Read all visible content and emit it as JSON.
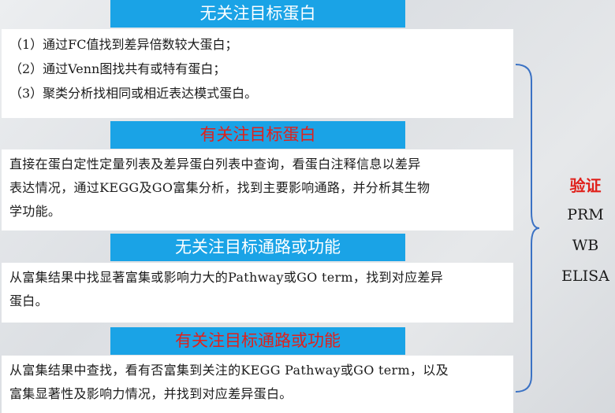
{
  "sections": [
    {
      "title": "无关注目标蛋白",
      "title_color": "#ffffff",
      "lines": [
        "（1）通过FC值找到差异倍数较大蛋白；",
        "（2）通过Venn图找共有或特有蛋白；",
        "（3）聚类分析找相同或相近表达模式蛋白。"
      ]
    },
    {
      "title": "有关注目标蛋白",
      "title_color": "#e0201b",
      "lines": [
        "直接在蛋白定性定量列表及差异蛋白列表中查询，看蛋白注释信息以差异",
        "表达情况，通过KEGG及GO富集分析，找到主要影响通路，并分析其生物",
        "学功能。"
      ]
    },
    {
      "title": "无关注目标通路或功能",
      "title_color": "#ffffff",
      "lines": [
        "从富集结果中找显著富集或影响力大的Pathway或GO  term，找到对应差异",
        "蛋白。"
      ]
    },
    {
      "title": "有关注目标通路或功能",
      "title_color": "#e0201b",
      "lines": [
        "从富集结果中查找，看有否富集到关注的KEGG  Pathway或GO  term，以及",
        "富集显著性及影响力情况，并找到对应差异蛋白。"
      ]
    }
  ],
  "verify": {
    "label": "验证",
    "methods": [
      "PRM",
      "WB",
      "ELISA"
    ]
  }
}
